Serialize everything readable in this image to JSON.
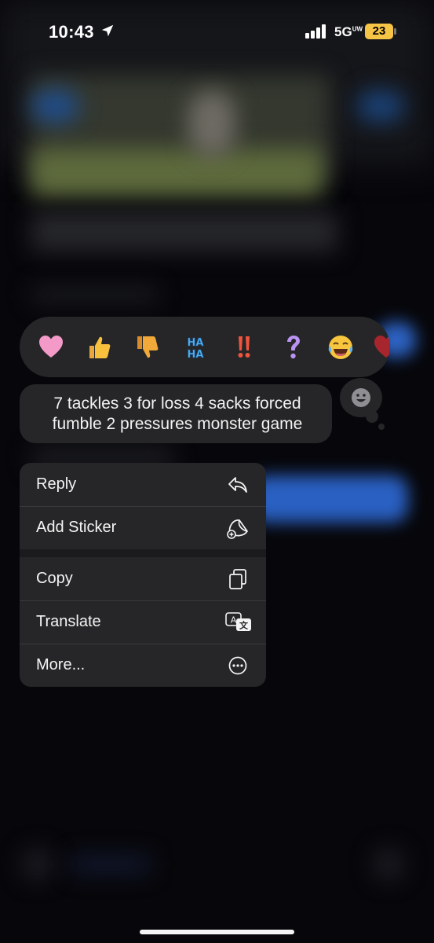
{
  "status_bar": {
    "time": "10:43",
    "network": "5G",
    "network_suffix": "UW",
    "battery": "23",
    "battery_color": "#f6c545"
  },
  "reactions": [
    {
      "name": "heart",
      "glyph": "🩷"
    },
    {
      "name": "thumbs-up",
      "glyph": "👍"
    },
    {
      "name": "thumbs-down",
      "glyph": "👎"
    },
    {
      "name": "haha",
      "glyph": "HA"
    },
    {
      "name": "exclamation",
      "glyph": "‼️"
    },
    {
      "name": "question",
      "glyph": "?"
    },
    {
      "name": "laughing",
      "glyph": "😂"
    }
  ],
  "message": {
    "text": "7 tackles 3 for loss 4 sacks forced fumble 2 pressures monster game"
  },
  "menu": {
    "items": [
      {
        "label": "Reply",
        "icon": "reply-icon"
      },
      {
        "label": "Add Sticker",
        "icon": "sticker-icon"
      },
      {
        "label": "Copy",
        "icon": "copy-icon"
      },
      {
        "label": "Translate",
        "icon": "translate-icon"
      },
      {
        "label": "More...",
        "icon": "more-icon"
      }
    ]
  },
  "colors": {
    "surface": "#262628",
    "background": "#07070b",
    "accent_blue": "#2a60c2"
  }
}
